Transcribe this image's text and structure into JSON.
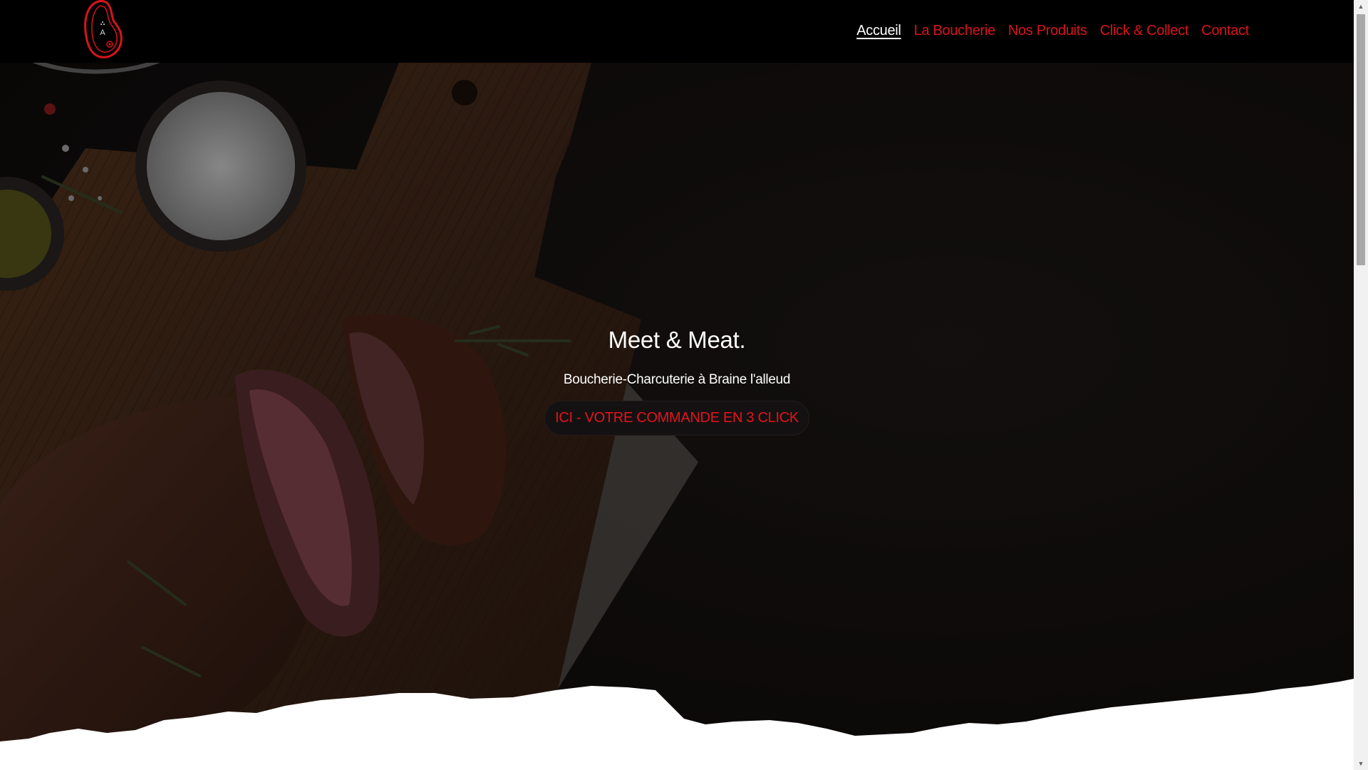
{
  "header": {
    "logo_letter": "A",
    "nav": [
      {
        "label": "Accueil",
        "active": true
      },
      {
        "label": "La Boucherie",
        "active": false
      },
      {
        "label": "Nos Produits",
        "active": false
      },
      {
        "label": "Click & Collect",
        "active": false
      },
      {
        "label": "Contact",
        "active": false
      }
    ]
  },
  "hero": {
    "title": "Meet & Meat.",
    "subtitle": "Boucherie-Charcuterie à Braine l'alleud",
    "cta_label": "ICI - VOTRE COMMANDE EN 3 CLICK"
  },
  "colors": {
    "accent": "#d8141b",
    "header_bg": "#000000",
    "hero_bg": "#161210",
    "board_wood": "#4a2d1a"
  }
}
